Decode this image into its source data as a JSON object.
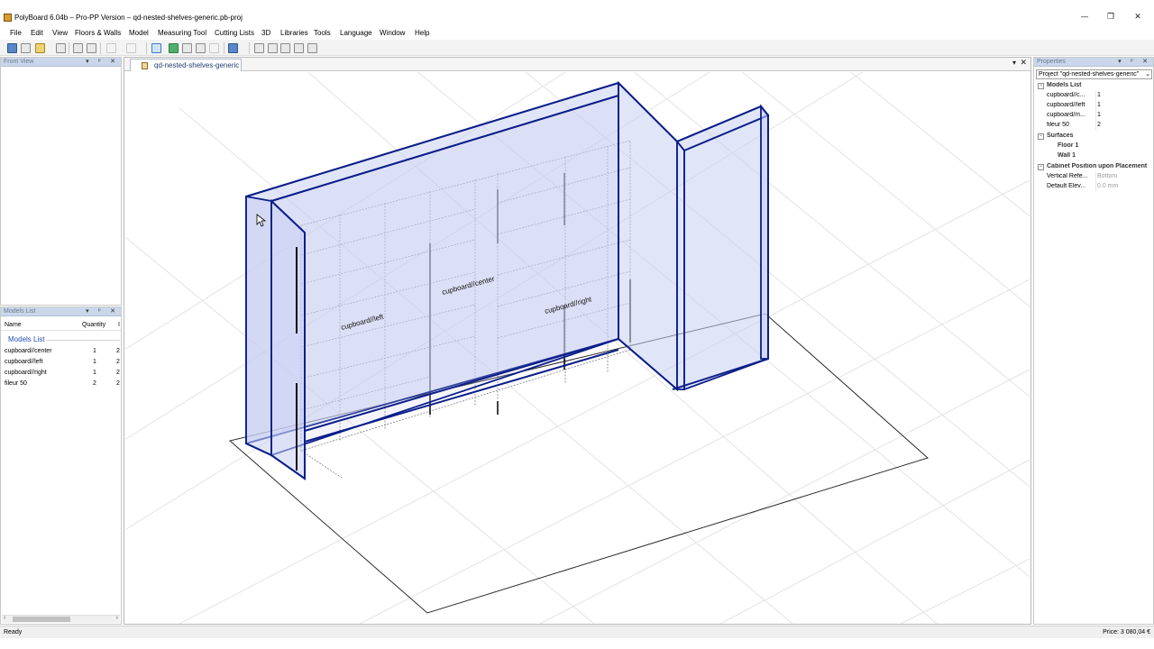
{
  "window": {
    "title": "PolyBoard 6.04b – Pro-PP Version – qd-nested-shelves-generic.pb-proj",
    "minimize_glyph": "—",
    "restore_glyph": "❐",
    "close_glyph": "✕"
  },
  "menu": [
    "File",
    "Edit",
    "View",
    "Floors & Walls",
    "Model",
    "Measuring Tool",
    "Cutting Lists",
    "3D",
    "Libraries",
    "Tools",
    "Language",
    "Window",
    "Help"
  ],
  "panels": {
    "front_view": {
      "title": "Front View",
      "controls": "▾ ᵖ ✕"
    },
    "models_list": {
      "title": "Models List",
      "controls": "▾ ᵖ ✕",
      "columns": [
        "Name",
        "Quantity",
        "I"
      ],
      "group": "Models List",
      "rows": [
        {
          "name": "cupboard//center",
          "qty": "1",
          "extra": "2"
        },
        {
          "name": "cupboard//left",
          "qty": "1",
          "extra": "2"
        },
        {
          "name": "cupboard//right",
          "qty": "1",
          "extra": "2"
        },
        {
          "name": "fileur 50",
          "qty": "2",
          "extra": "2"
        }
      ]
    },
    "properties": {
      "title": "Properties",
      "controls": "▾ ᵖ ✕",
      "selector": "Project \"qd-nested-shelves-generic\"",
      "rows": [
        {
          "type": "section",
          "label": "Models List",
          "box": "⊟"
        },
        {
          "type": "item",
          "label": "cupboard//c...",
          "value": "1"
        },
        {
          "type": "item",
          "label": "cupboard//left",
          "value": "1"
        },
        {
          "type": "item",
          "label": "cupboard//ri...",
          "value": "1"
        },
        {
          "type": "item",
          "label": "fileur 50",
          "value": "2"
        },
        {
          "type": "section",
          "label": "Surfaces",
          "box": "⊟"
        },
        {
          "type": "sub",
          "label": "Floor 1"
        },
        {
          "type": "sub",
          "label": "Wall 1"
        },
        {
          "type": "section",
          "label": "Cabinet Position upon Placement",
          "box": "⊟"
        },
        {
          "type": "item",
          "label": "Vertical Refe...",
          "value": "Bottom",
          "grey": true
        },
        {
          "type": "item",
          "label": "Default Elev...",
          "value": "0.0 mm",
          "grey": true
        }
      ]
    }
  },
  "document": {
    "tab_label": "qd-nested-shelves-generic",
    "tab_menu_glyph": "▾",
    "tab_close_glyph": "✕"
  },
  "viewport": {
    "labels": {
      "left": "cupboard//left",
      "center": "cupboard//center",
      "right": "cupboard//right"
    },
    "colors": {
      "wall_stroke": "#0b1e8a",
      "wall_fill": "#c8cff2",
      "grid": "#e3e3e3",
      "cabinet": "#6a6a6a"
    }
  },
  "status": {
    "left": "Ready",
    "price": "Price: 3 080,04 €"
  },
  "scroll_arrows": {
    "left": "‹",
    "right": "›"
  }
}
